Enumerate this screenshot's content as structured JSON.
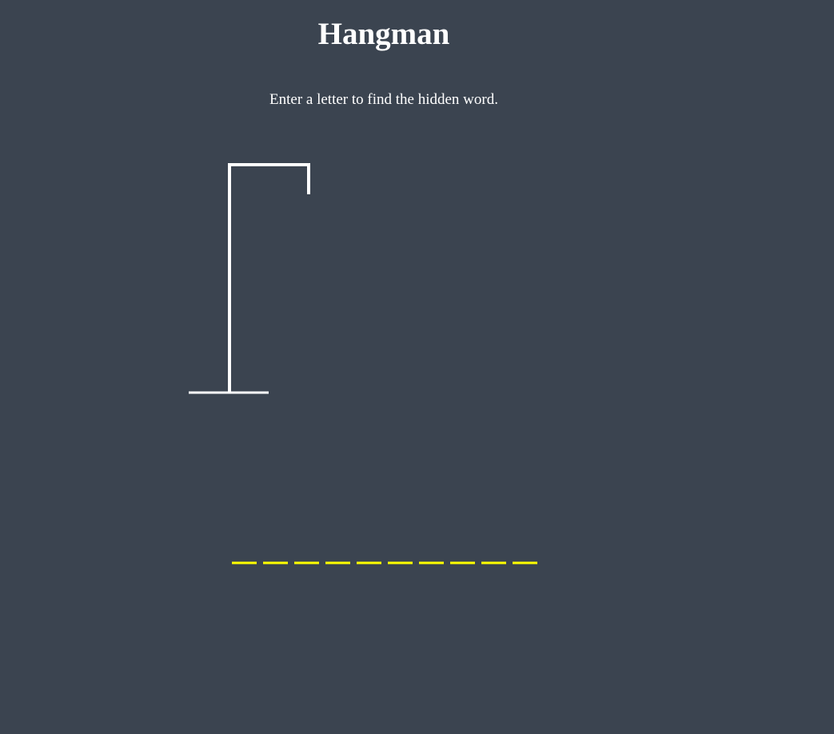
{
  "game": {
    "title": "Hangman",
    "instruction": "Enter a letter to find the hidden word.",
    "wrong_guesses": 0,
    "hidden_word": {
      "letter_count": 10,
      "revealed_letters": [
        "",
        "",
        "",
        "",
        "",
        "",
        "",
        "",
        "",
        ""
      ]
    }
  },
  "colors": {
    "background": "#3b4450",
    "text": "#ffffff",
    "gallows": "#ffffff",
    "letter_slot": "#ffff00"
  }
}
